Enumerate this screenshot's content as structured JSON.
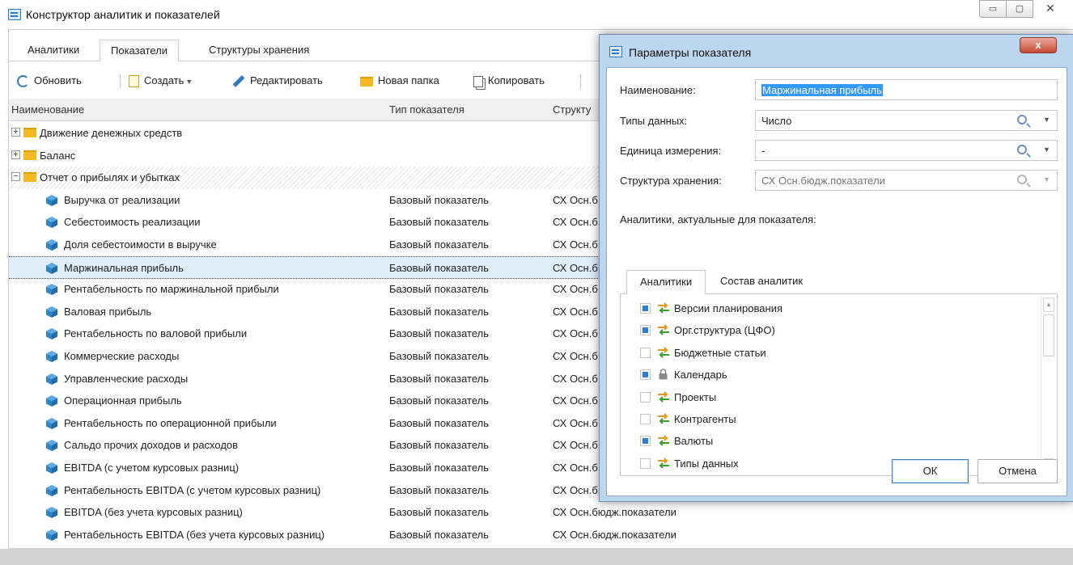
{
  "window": {
    "title": "Конструктор аналитик и показателей"
  },
  "tabs": [
    "Аналитики",
    "Показатели",
    "Структуры хранения"
  ],
  "toolbar": {
    "refresh": "Обновить",
    "create": "Создать",
    "edit": "Редактировать",
    "new_folder": "Новая папка",
    "copy": "Копировать"
  },
  "grid": {
    "columns": [
      "Наименование",
      "Тип показателя",
      "Структу"
    ],
    "folders": [
      "Движение денежных средств",
      "Баланс",
      "Отчет о прибылях и убытках"
    ],
    "rows": [
      {
        "name": "Выручка от реализации",
        "type": "Базовый показатель",
        "storage": "СХ Осн.б"
      },
      {
        "name": "Себестоимость реализации",
        "type": "Базовый показатель",
        "storage": "СХ Осн.б"
      },
      {
        "name": "Доля себестоимости в выручке",
        "type": "Базовый показатель",
        "storage": "СХ Осн.б"
      },
      {
        "name": "Маржинальная прибыль",
        "type": "Базовый показатель",
        "storage": "СХ Осн.б"
      },
      {
        "name": "Рентабельность по маржинальной прибыли",
        "type": "Базовый показатель",
        "storage": "СХ Осн.б"
      },
      {
        "name": "Валовая прибыль",
        "type": "Базовый показатель",
        "storage": "СХ Осн.б"
      },
      {
        "name": "Рентабельность по валовой прибыли",
        "type": "Базовый показатель",
        "storage": "СХ Осн.б"
      },
      {
        "name": "Коммерческие расходы",
        "type": "Базовый показатель",
        "storage": "СХ Осн.б"
      },
      {
        "name": "Управленческие расходы",
        "type": "Базовый показатель",
        "storage": "СХ Осн.б"
      },
      {
        "name": "Операционная прибыль",
        "type": "Базовый показатель",
        "storage": "СХ Осн.б"
      },
      {
        "name": "Рентабельность по операционной прибыли",
        "type": "Базовый показатель",
        "storage": "СХ Осн.б"
      },
      {
        "name": "Сальдо прочих доходов и расходов",
        "type": "Базовый показатель",
        "storage": "СХ Осн.б"
      },
      {
        "name": "EBITDA (с учетом курсовых разниц)",
        "type": "Базовый показатель",
        "storage": "СХ Осн.б"
      },
      {
        "name": "Рентабельность EBITDA (с учетом курсовых разниц)",
        "type": "Базовый показатель",
        "storage": "СХ Осн.б"
      },
      {
        "name": "EBITDA (без учета курсовых разниц)",
        "type": "Базовый показатель",
        "storage": "СХ Осн.бюдж.показатели"
      },
      {
        "name": "Рентабельность EBITDA (без учета курсовых разниц)",
        "type": "Базовый показатель",
        "storage": "СХ Осн.бюдж.показатели"
      }
    ]
  },
  "dialog": {
    "title": "Параметры показателя",
    "close": "x",
    "fields": {
      "name_label": "Наименование:",
      "name_value": "Маржинальная прибыль",
      "data_types_label": "Типы данных:",
      "data_types_value": "Число",
      "unit_label": "Единица измерения:",
      "unit_value": "-",
      "storage_label": "Структура хранения:",
      "storage_value": "СХ Осн.бюдж.показатели"
    },
    "analytics_caption": "Аналитики, актуальные для показателя:",
    "tabs": [
      "Аналитики",
      "Состав аналитик"
    ],
    "analytics": [
      {
        "label": "Версии планирования",
        "checked": true
      },
      {
        "label": "Орг.структура (ЦФО)",
        "checked": true
      },
      {
        "label": "Бюджетные статьи",
        "checked": false
      },
      {
        "label": "Календарь",
        "checked": true
      },
      {
        "label": "Проекты",
        "checked": false
      },
      {
        "label": "Контрагенты",
        "checked": false
      },
      {
        "label": "Валюты",
        "checked": true
      },
      {
        "label": "Типы данных",
        "checked": false
      }
    ],
    "ok": "ОК",
    "cancel": "Отмена"
  },
  "colors": {
    "accent": "#2a7fd4",
    "folder": "#f5b822",
    "cube": "#2e86c9",
    "dialog_frame": "#bcd6f0",
    "selection": "#dfeef9"
  }
}
